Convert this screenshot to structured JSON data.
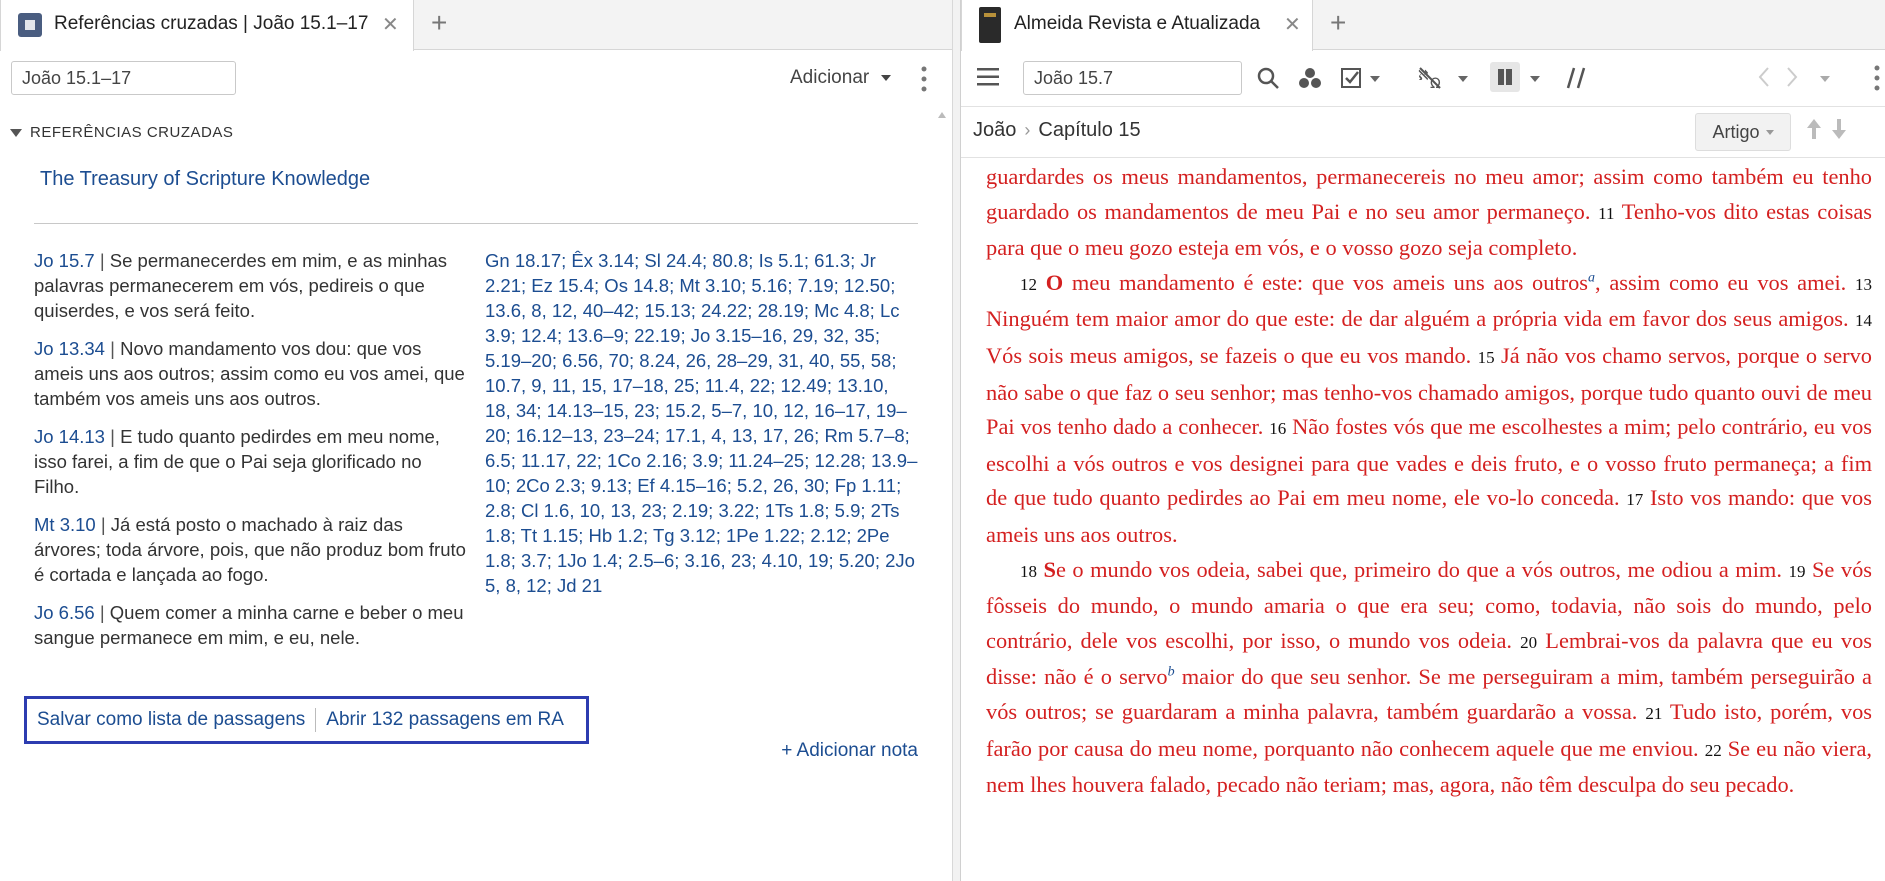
{
  "left": {
    "tab_title": "Referências cruzadas | João 15.1–17",
    "tab_close": "✕",
    "tab_add": "+",
    "reference_input": "João 15.1–17",
    "add_button": "Adicionar",
    "section_header": "REFERÊNCIAS CRUZADAS",
    "source_title": "The Treasury of Scripture Knowledge",
    "refs": [
      {
        "id": "Jo 15.7",
        "sep": "|",
        "text": "Se permanecerdes em mim, e as minhas palavras permanecerem em vós, pedireis o que quiserdes, e vos será feito."
      },
      {
        "id": "Jo 13.34",
        "sep": "|",
        "text": "Novo mandamento vos dou: que vos ameis uns aos outros; assim como eu vos amei, que também vos ameis uns aos outros."
      },
      {
        "id": "Jo 14.13",
        "sep": "|",
        "text": "E tudo quanto pedirdes em meu nome, isso farei, a fim de que o Pai seja glorificado no Filho."
      },
      {
        "id": "Mt 3.10",
        "sep": "|",
        "text": "Já está posto o machado à raiz das árvores; toda árvore, pois, que não produz bom fruto é cortada e lançada ao fogo."
      },
      {
        "id": "Jo 6.56",
        "sep": "|",
        "text": "Quem comer a minha carne e beber o meu sangue permanece em mim, e eu, nele."
      }
    ],
    "ref_block": "Gn 18.17; Êx 3.14; Sl 24.4; 80.8; Is 5.1; 61.3; Jr 2.21; Ez 15.4; Os 14.8; Mt 3.10; 5.16; 7.19; 12.50; 13.6, 8, 12, 40–42; 15.13; 24.22; 28.19; Mc 4.8; Lc 3.9; 12.4; 13.6–9; 22.19; Jo 3.15–16, 29, 32, 35; 5.19–20; 6.56, 70; 8.24, 26, 28–29, 31, 40, 55, 58; 10.7, 9, 11, 15, 17–18, 25; 11.4, 22; 12.49; 13.10, 18, 34; 14.13–15, 23; 15.2, 5–7, 10, 12, 16–17, 19–20; 16.12–13, 23–24; 17.1, 4, 13, 17, 26; Rm 5.7–8; 6.5; 11.17, 22; 1Co 2.16; 3.9; 11.24–25; 12.28; 13.9–10; 2Co 2.3; 9.13; Ef 4.15–16; 5.2, 26, 30; Fp 1.11; 2.8; Cl 1.6, 10, 13, 23; 2.19; 3.22; 1Ts 1.8; 5.9; 2Ts 1.8; Tt 1.15; Hb 1.2; Tg 3.12; 1Pe 1.22; 2.12; 2Pe 1.8; 3.7; 1Jo 1.4; 2.5–6; 3.16, 23; 4.10, 19; 5.20; 2Jo 5, 8, 12; Jd 21",
    "save_list": "Salvar como lista de passagens",
    "open_passages": "Abrir 132 passagens em RA",
    "add_note": "+ Adicionar nota"
  },
  "right": {
    "tab_title": "Almeida Revista e Atualizada",
    "tab_close": "✕",
    "tab_add": "+",
    "reference_input": "João 15.7",
    "breadcrumb": {
      "book": "João",
      "sep": "›",
      "chapter": "Capítulo 15"
    },
    "view_button": "Artigo",
    "text": {
      "p1": "guardardes os meus mandamentos, permanecereis no meu amor; assim como também eu tenho guardado os mandamentos de meu Pai e no seu amor permaneço.",
      "v11_num": "11",
      "v11": "Tenho-vos dito estas coisas para que o meu gozo esteja em vós, e o vosso gozo seja completo.",
      "v12_num": "12",
      "v12_cap": "O",
      "v12a": " meu mandamento é este: que vos ameis uns aos outros",
      "fn_a": "a",
      "v12b": ", assim como eu vos amei.",
      "v13_num": "13",
      "v13": "Ninguém tem maior amor do que este: de dar alguém a própria vida em favor dos seus amigos.",
      "v14_num": "14",
      "v14": "Vós sois meus amigos, se fazeis o que eu vos mando.",
      "v15_num": "15",
      "v15": "Já não vos chamo servos, porque o servo não sabe o que faz o seu senhor; mas tenho-vos chamado amigos, porque tudo quanto ouvi de meu Pai vos tenho dado a conhecer.",
      "v16_num": "16",
      "v16": "Não fostes vós que me escolhestes a mim; pelo contrário, eu vos escolhi a vós outros e vos designei para que vades e deis fruto, e o vosso fruto permaneça; a fim de que tudo quanto pedirdes ao Pai em meu nome, ele vo-lo conceda.",
      "v17_num": "17",
      "v17": "Isto vos mando: que vos ameis uns aos outros.",
      "v18_num": "18",
      "v18_cap": "S",
      "v18": "e o mundo vos odeia, sabei que, primeiro do que a vós outros, me odiou a mim.",
      "v19_num": "19",
      "v19": "Se vós fôsseis do mundo, o mundo amaria o que era seu; como, todavia, não sois do mundo, pelo contrário, dele vos escolhi, por isso, o mundo vos odeia.",
      "v20_num": "20",
      "v20a": "Lembrai-vos da palavra que eu vos disse: não é o servo",
      "fn_b": "b",
      "v20b": " maior do que seu senhor. Se me perseguiram a mim, também perseguirão a vós outros; se guardaram a minha palavra, também guardarão a vossa.",
      "v21_num": "21",
      "v21": "Tudo isto, porém, vos farão por causa do meu nome, porquanto não conhecem aquele que me enviou.",
      "v22_num": "22",
      "v22": "Se eu não viera, nem lhes houvera falado, pecado não teriam; mas, agora, não têm desculpa do seu pecado."
    }
  },
  "colors": {
    "link": "#1c4d91",
    "scripture_red": "#d42020",
    "highlight_box": "#2d3cb0"
  }
}
